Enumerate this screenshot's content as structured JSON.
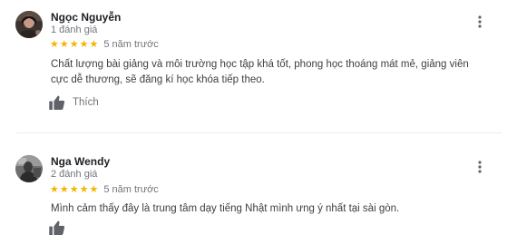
{
  "reviews": [
    {
      "name": "Ngọc Nguyễn",
      "review_count": "1 đánh giá",
      "stars": 5,
      "time": "5 năm trước",
      "text": "Chất lượng bài giảng và môi trường học tập khá tốt, phong học thoáng mát mẻ, giảng viên cực dễ thương, sẽ đăng kí học khóa tiếp theo.",
      "like_label": "Thích"
    },
    {
      "name": "Nga Wendy",
      "review_count": "2 đánh giá",
      "stars": 5,
      "time": "5 năm trước",
      "text": "Mình cảm thấy đây là trung tâm dạy tiếng Nhật mình ưng ý nhất tại sài gòn."
    }
  ],
  "colors": {
    "star": "#f4b400",
    "secondary_text": "#70757a"
  },
  "icons": {
    "like": "thumbs-up-icon",
    "menu": "more-vertical-icon"
  }
}
